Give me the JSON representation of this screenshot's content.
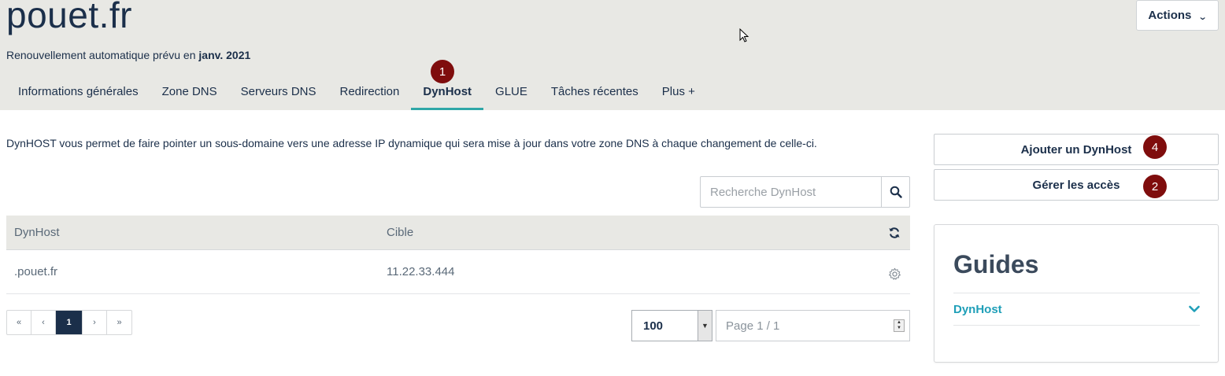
{
  "header": {
    "domain": "pouet.fr",
    "renewal_prefix": "Renouvellement automatique prévu en ",
    "renewal_date": "janv. 2021",
    "actions_label": "Actions"
  },
  "tabs": [
    {
      "label": "Informations générales"
    },
    {
      "label": "Zone DNS"
    },
    {
      "label": "Serveurs DNS"
    },
    {
      "label": "Redirection"
    },
    {
      "label": "DynHost",
      "active": true
    },
    {
      "label": "GLUE"
    },
    {
      "label": "Tâches récentes"
    },
    {
      "label": "Plus +"
    }
  ],
  "badges": {
    "tab": "1",
    "add": "4",
    "access": "2"
  },
  "main": {
    "description": "DynHOST vous permet de faire pointer un sous-domaine vers une adresse IP dynamique qui sera mise à jour dans votre zone DNS à chaque changement de celle-ci.",
    "search_placeholder": "Recherche DynHost"
  },
  "table": {
    "columns": [
      "DynHost",
      "Cible"
    ],
    "rows": [
      {
        "dynhost": ".pouet.fr",
        "cible": "11.22.33.444"
      }
    ]
  },
  "pagination": {
    "first": "«",
    "prev": "‹",
    "current": "1",
    "next": "›",
    "last": "»",
    "per_page": "100",
    "page_info": "Page 1 / 1"
  },
  "sidebar": {
    "add_dynhost": "Ajouter un DynHost",
    "manage_access": "Gérer les accès",
    "guides_title": "Guides",
    "guide_item": "DynHost"
  },
  "colors": {
    "accent_teal": "#2fa7a7",
    "badge_red": "#7f0d0d",
    "navy": "#1b2f4a",
    "link_blue": "#1f9fb8"
  }
}
